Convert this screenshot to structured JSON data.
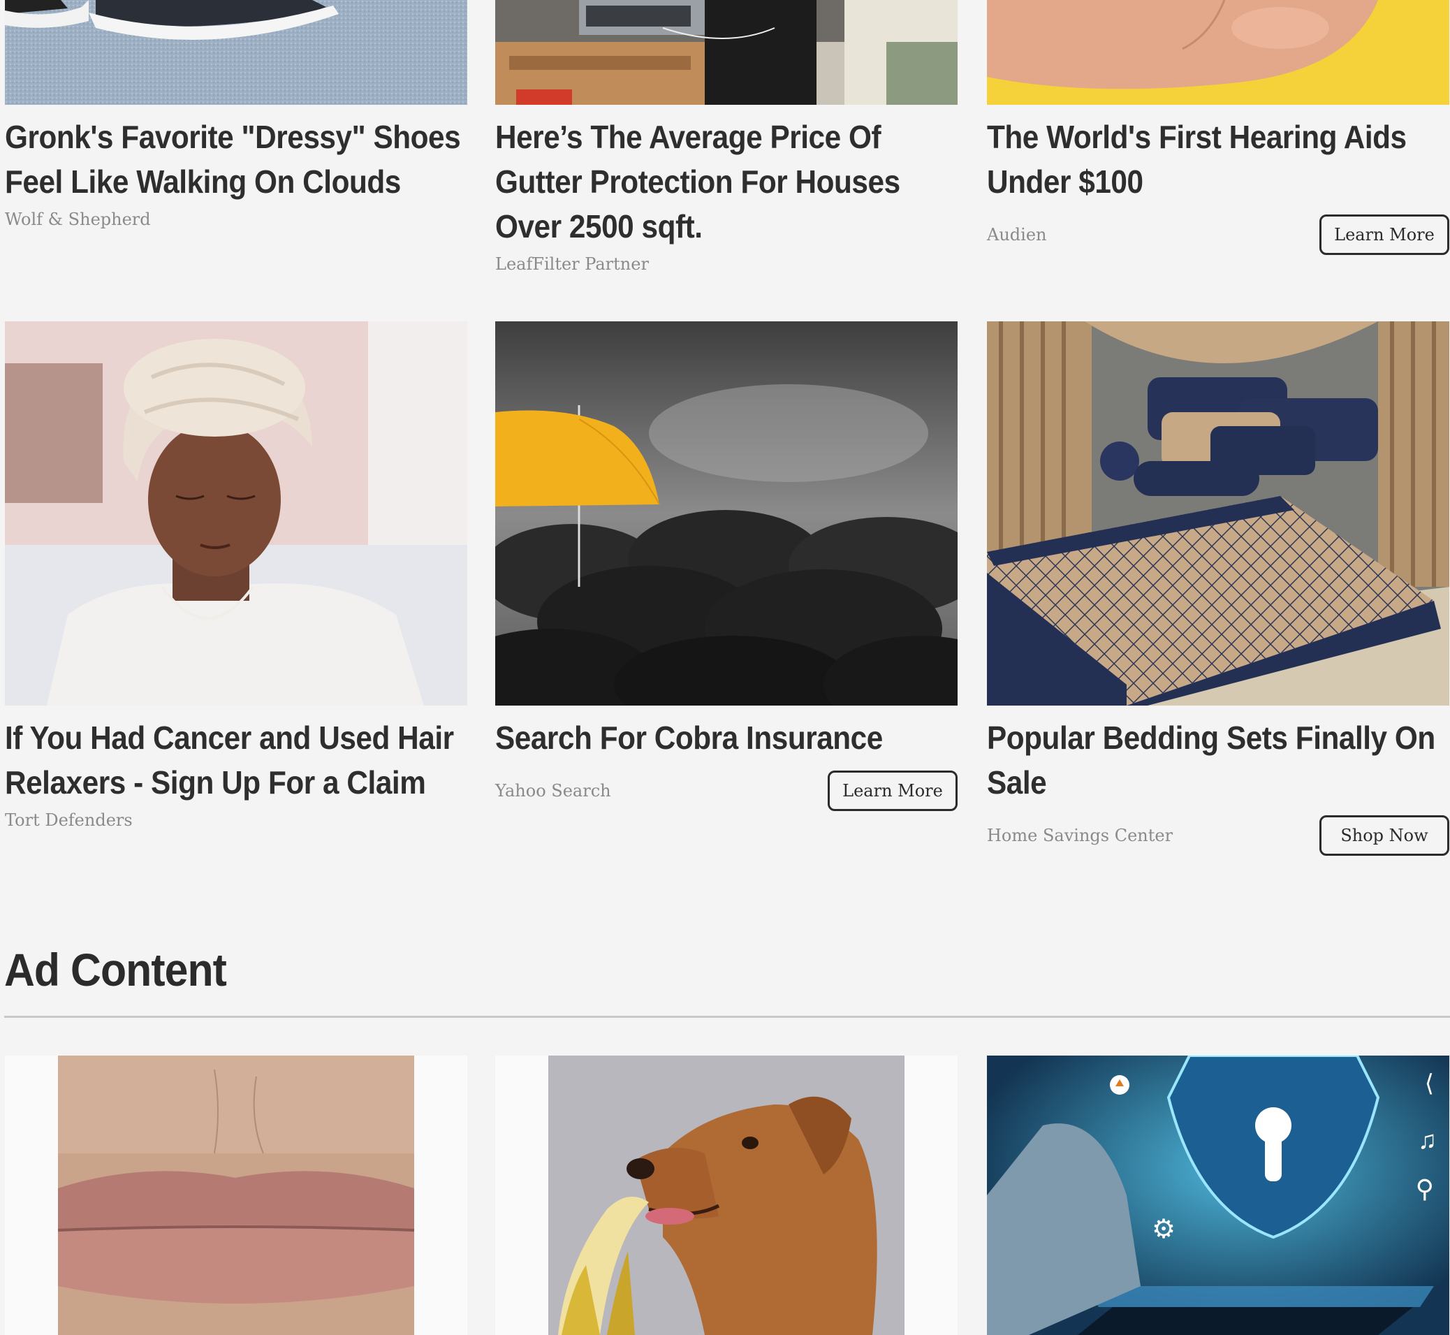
{
  "row1": [
    {
      "title": "Gronk's Favorite \"Dressy\" Shoes Feel Like Walking On Clouds",
      "source": "Wolf & Shepherd",
      "button": ""
    },
    {
      "title": "Here’s The Average Price Of Gutter Protection For Houses Over 2500 sqft.",
      "source": "LeafFilter Partner",
      "button": ""
    },
    {
      "title": "The World's First Hearing Aids Under $100",
      "source": "Audien",
      "button": "Learn More"
    }
  ],
  "row2": [
    {
      "title": "If You Had Cancer and Used Hair Relaxers - Sign Up For a Claim",
      "source": "Tort Defenders",
      "button": ""
    },
    {
      "title": "Search For Cobra Insurance",
      "source": "Yahoo Search",
      "button": "Learn More"
    },
    {
      "title": "Popular Bedding Sets Finally On Sale",
      "source": "Home Savings Center",
      "button": "Shop Now"
    }
  ],
  "section": {
    "title": "Ad Content"
  },
  "icons": [
    "share-icon",
    "music-note-icon",
    "search-icon",
    "gear-icon",
    "upload-cloud-icon",
    "keyhole-icon"
  ]
}
